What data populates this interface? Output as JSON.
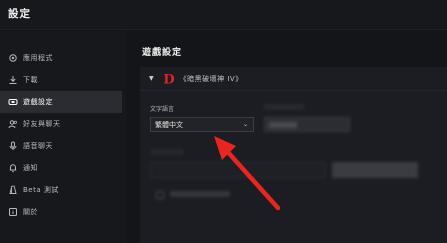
{
  "app": {
    "title": "設定"
  },
  "sidebar": {
    "items": [
      {
        "label": "應用程式",
        "icon": "gear-icon",
        "active": false
      },
      {
        "label": "下載",
        "icon": "download-icon",
        "active": false
      },
      {
        "label": "遊戲設定",
        "icon": "game-controller-icon",
        "active": true
      },
      {
        "label": "好友與聊天",
        "icon": "friends-icon",
        "active": false
      },
      {
        "label": "語音聊天",
        "icon": "microphone-icon",
        "active": false
      },
      {
        "label": "通知",
        "icon": "bell-icon",
        "active": false
      },
      {
        "label": "Beta 測試",
        "icon": "beta-icon",
        "active": false
      },
      {
        "label": "關於",
        "icon": "info-icon",
        "active": false
      }
    ]
  },
  "main": {
    "section_title": "遊戲設定",
    "game": {
      "logo_letter": "D",
      "name": "《暗黑破壞神 IV》",
      "text_language_label": "文字語言",
      "text_language_value": "繁體中文"
    }
  },
  "colors": {
    "accent_red": "#e0242a",
    "arrow_red": "#e8261f"
  }
}
